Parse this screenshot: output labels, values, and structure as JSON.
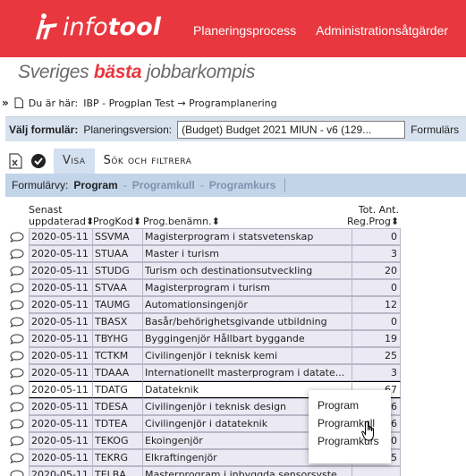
{
  "header": {
    "logo_text_prefix": "info",
    "logo_text_bold": "tool",
    "nav": [
      "Planeringsprocess",
      "Administrationsåtgärder"
    ],
    "brand_color": "#e8373f"
  },
  "slogan": {
    "pre": "Sveriges ",
    "bold": "bästa",
    "post": " jobbarkompis"
  },
  "breadcrumb": {
    "prefix": "Du är här:",
    "path": "IBP - Progplan Test → Programplanering"
  },
  "form": {
    "label": "Välj formulär:",
    "version_label": "Planeringsversion:",
    "version_value": "(Budget) Budget 2021 MIUN - v6 (129...",
    "trailing_label": "Formulärs"
  },
  "tabs": {
    "visa": "Visa",
    "sok": "Sök och filtrera"
  },
  "view": {
    "label": "Formulärvy:",
    "active": "Program",
    "others": [
      "Programkull",
      "Programkurs"
    ]
  },
  "table": {
    "headers": {
      "updated_l1": "Senast",
      "updated_l2": "uppdaterad",
      "code": "ProgKod",
      "name": "Prog.benämn.",
      "reg_l1": "Tot. Ant.",
      "reg_l2": "Reg.Prog"
    },
    "sort_icon": "sort-arrows-icon",
    "rows": [
      {
        "date": "2020-05-11",
        "code": "SSVMA",
        "name": "Magisterprogram i statsvetenskap",
        "reg": "0"
      },
      {
        "date": "2020-05-11",
        "code": "STUAA",
        "name": "Master i turism",
        "reg": "3"
      },
      {
        "date": "2020-05-11",
        "code": "STUDG",
        "name": "Turism och destinationsutveckling",
        "reg": "20"
      },
      {
        "date": "2020-05-11",
        "code": "STVAA",
        "name": "Magisterprogram i turism",
        "reg": "0"
      },
      {
        "date": "2020-05-11",
        "code": "TAUMG",
        "name": "Automationsingenjör",
        "reg": "12"
      },
      {
        "date": "2020-05-11",
        "code": "TBASX",
        "name": "Basår/behörighetsgivande utbildning",
        "reg": "0"
      },
      {
        "date": "2020-05-11",
        "code": "TBYHG",
        "name": "Byggingenjör Hållbart byggande",
        "reg": "19"
      },
      {
        "date": "2020-05-11",
        "code": "TCTKM",
        "name": "Civilingenjör i teknisk kemi",
        "reg": "25"
      },
      {
        "date": "2020-05-11",
        "code": "TDAAA",
        "name": "Internationellt masterprogram i datate...",
        "reg": "3"
      },
      {
        "date": "2020-05-11",
        "code": "TDATG",
        "name": "Datateknik",
        "reg": "67"
      },
      {
        "date": "2020-05-11",
        "code": "TDESA",
        "name": "Civilingenjör i teknisk design",
        "reg": "6"
      },
      {
        "date": "2020-05-11",
        "code": "TDTEA",
        "name": "Civilingenjör i datateknik",
        "reg": "6"
      },
      {
        "date": "2020-05-11",
        "code": "TEKOG",
        "name": "Ekoingenjör",
        "reg": "0"
      },
      {
        "date": "2020-05-11",
        "code": "TEKRG",
        "name": "Elkraftingenjör",
        "reg": "5"
      },
      {
        "date": "2020-05-11",
        "code": "TELBA",
        "name": "Masterprogram i inbyggda sensorsyste...",
        "reg": ""
      }
    ]
  },
  "context_menu": [
    "Program",
    "Programkull",
    "Programkurs"
  ]
}
